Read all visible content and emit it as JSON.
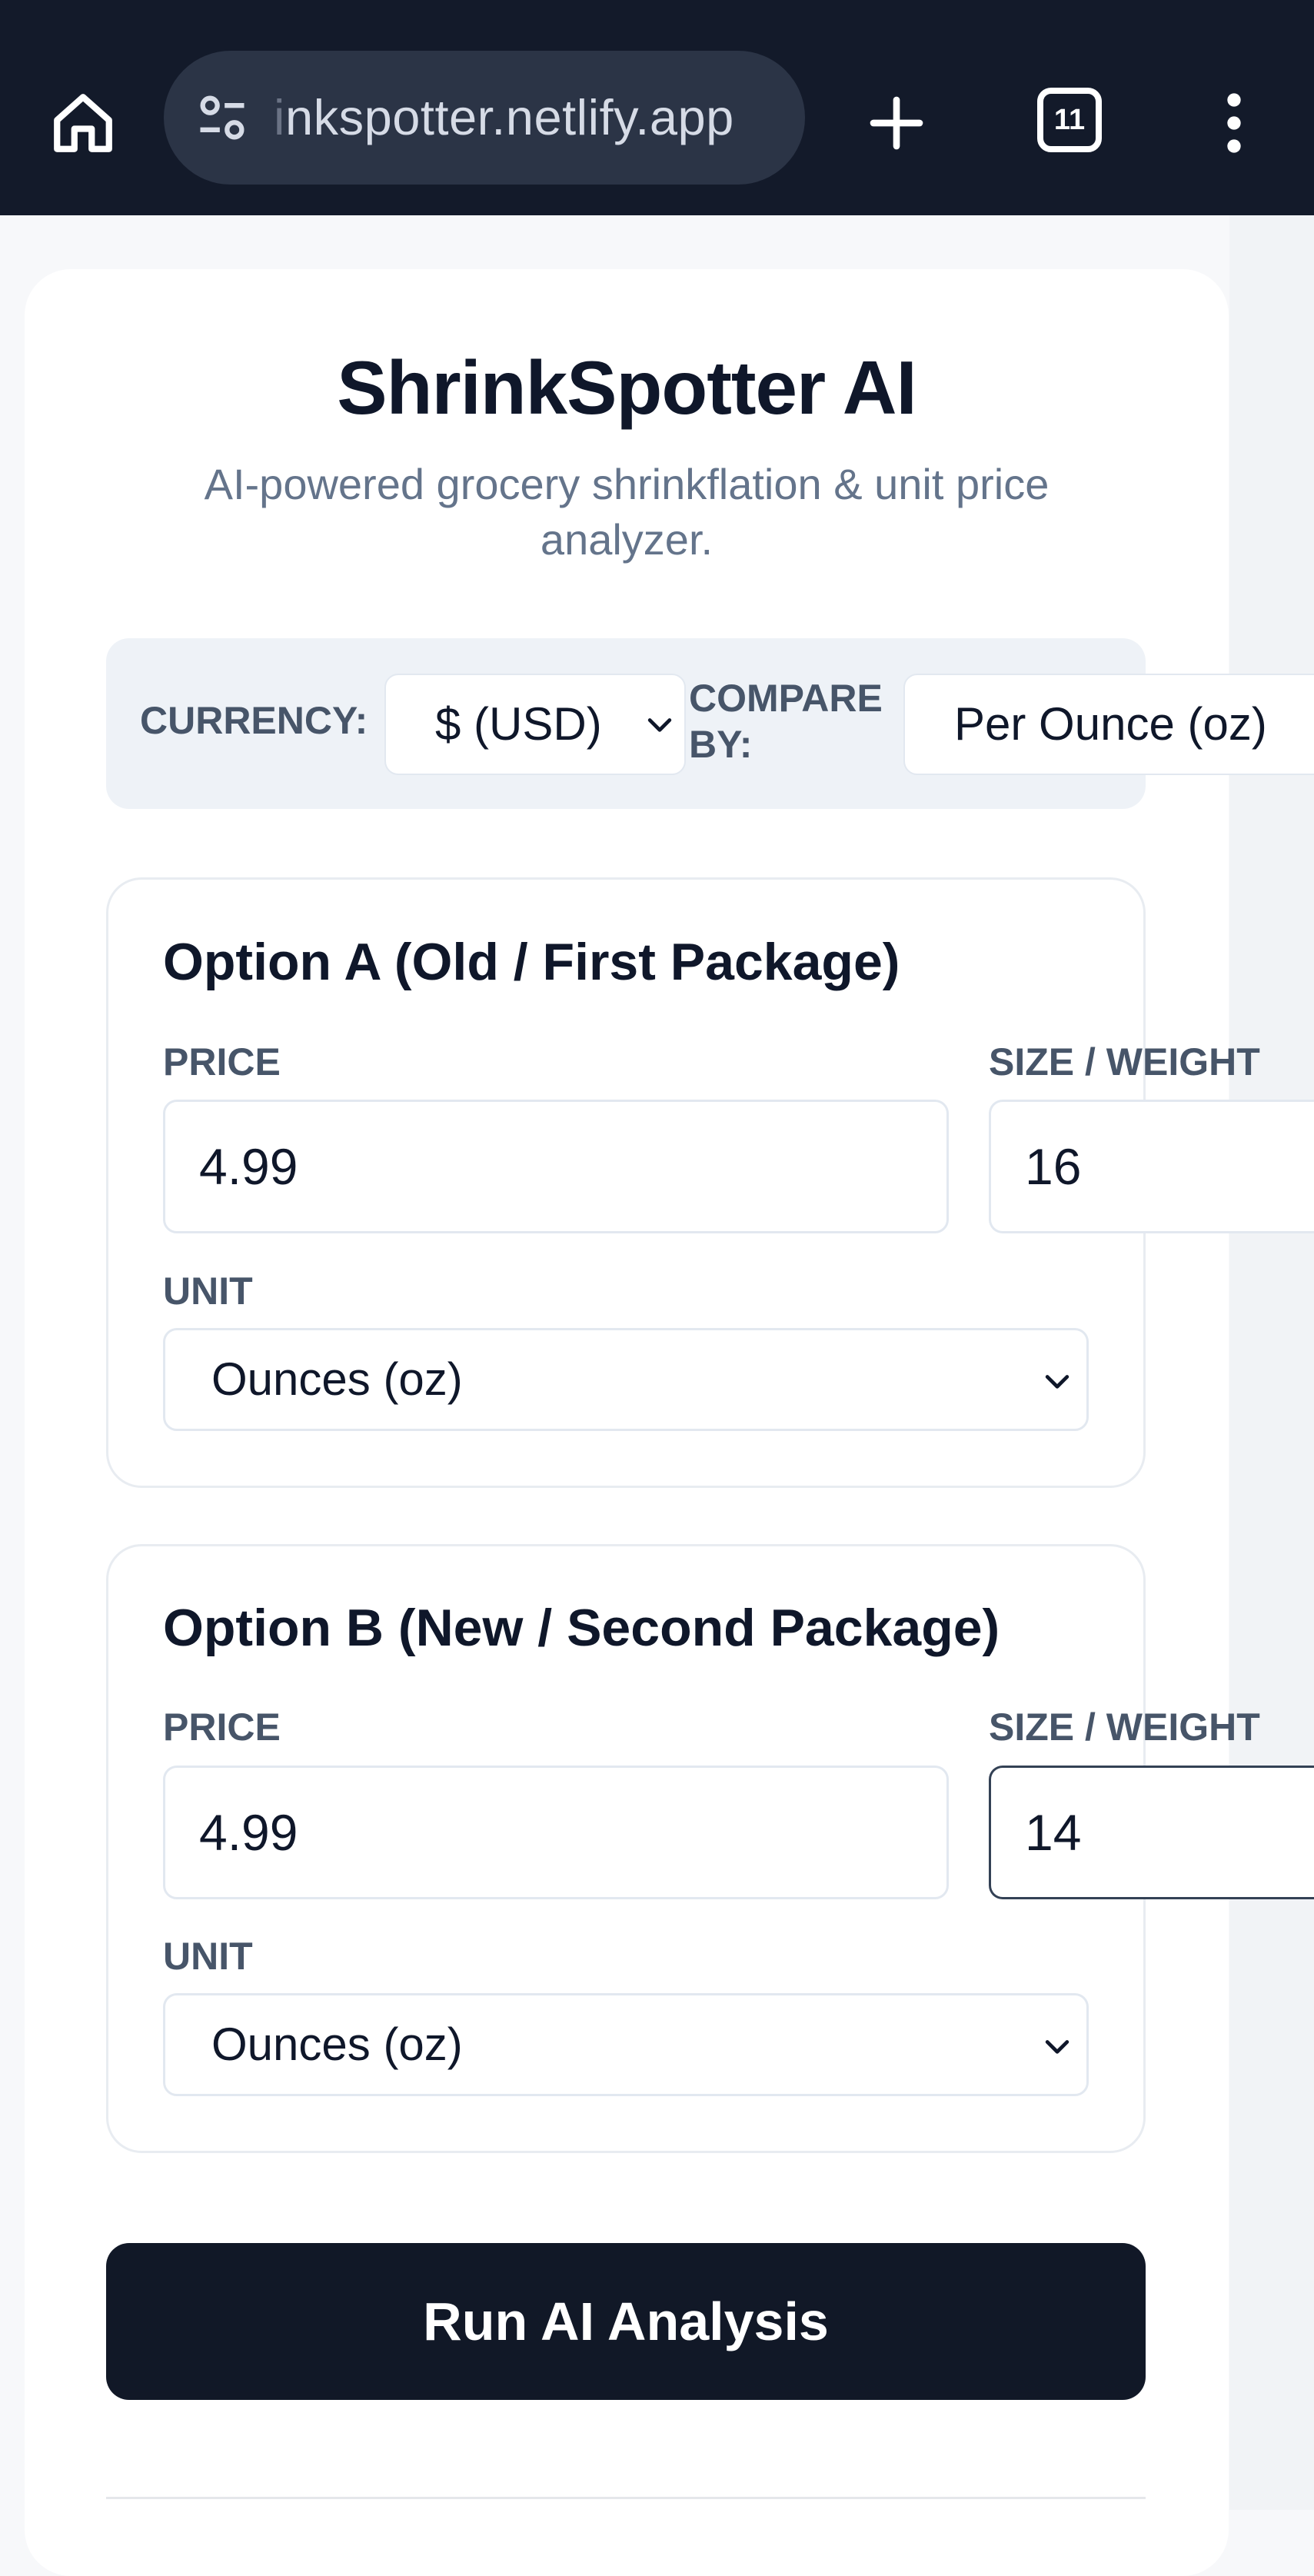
{
  "browser": {
    "url_prefix": "i",
    "url_text": "nkspotter.netlify.app",
    "tab_count": "11",
    "icons": {
      "home": "home-icon",
      "site_settings": "tune-icon",
      "new_tab": "plus-icon",
      "tabs": "tab-switcher-icon",
      "menu": "more-vert-icon"
    }
  },
  "header": {
    "title": "ShrinkSpotter AI",
    "subtitle": "AI-powered grocery shrinkflation & unit price analyzer."
  },
  "settings": {
    "currency_label": "CURRENCY:",
    "currency_value": "$ (USD)",
    "compare_label": "COMPARE BY:",
    "compare_value": "Per Ounce (oz)"
  },
  "option_a": {
    "title": "Option A (Old / First Package)",
    "price_label": "PRICE",
    "price_value": "4.99",
    "size_label": "SIZE / WEIGHT",
    "size_value": "16",
    "unit_label": "UNIT",
    "unit_value": "Ounces (oz)"
  },
  "option_b": {
    "title": "Option B (New / Second Package)",
    "price_label": "PRICE",
    "price_value": "4.99",
    "size_label": "SIZE / WEIGHT",
    "size_value": "14",
    "unit_label": "UNIT",
    "unit_value": "Ounces (oz)"
  },
  "actions": {
    "run_label": "Run AI Analysis"
  },
  "colors": {
    "chrome_bg": "#131a2a",
    "primary_button": "#111827",
    "muted_text": "#64748b",
    "label_text": "#475569"
  }
}
